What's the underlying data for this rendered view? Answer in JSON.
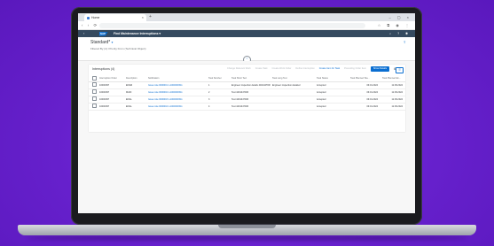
{
  "browser": {
    "tab_title": "Home",
    "tab_close": "×",
    "new_tab": "+",
    "window_controls": "– ▢ ×",
    "nav": "‹ › ⟳",
    "extensions": "☆ ⧉ ◉ ⋮"
  },
  "shell": {
    "back": "‹",
    "logo": "SAP",
    "title": "Find Maintenance Interruptions ▾",
    "icons": "⌕ ? ◉"
  },
  "header": {
    "variant": "Standard*",
    "variant_chevron": "▾",
    "subtitle": "Filtered By (4): Priority From (Technical Object)",
    "expander": "⌃",
    "share": "⇪"
  },
  "table": {
    "title": "Interruptions (4)",
    "actions": [
      {
        "label": "Change Relevant Work",
        "state": "disabled"
      },
      {
        "label": "Create Task",
        "state": "disabled"
      },
      {
        "label": "Create Work Order",
        "state": "disabled"
      },
      {
        "label": "Define Interruption",
        "state": "disabled"
      },
      {
        "label": "Create Item for Task",
        "state": "enabled"
      },
      {
        "label": "Preceding Order Item",
        "state": "disabled"
      },
      {
        "label": "Show Details",
        "state": "button"
      }
    ],
    "settings_icon": "⚙",
    "view_toggle": "☰",
    "columns": [
      "Interruption Order",
      "Description",
      "Notification",
      "Task Number",
      "Task Short Text",
      "Task Long Text",
      "Task Status",
      "Task Planned Sta...",
      "Task Planned En..."
    ],
    "rows": [
      [
        "10000097",
        "ENGR",
        "Issue note 0000001 1-1000001511",
        "1",
        "Engineer inspection details 4401447003",
        "Engineer inspection detailed",
        "Accepted",
        "09.01.2024",
        "12.09.2024"
      ],
      [
        "10000097",
        "MAIN",
        "Issue note 0000002 1-1000001511",
        "2",
        "Test 4401447003",
        "",
        "Accepted",
        "09.01.2024",
        "12.09.2024"
      ],
      [
        "10000097",
        "ENGL",
        "Issue note 0000003 1-1000001511",
        "3",
        "Test 4401447003",
        "",
        "Accepted",
        "09.01.2024",
        "12.09.2024"
      ],
      [
        "10000097",
        "ENGL",
        "Issue note 0000004 1-1000001511",
        "4",
        "Test 4401447003",
        "",
        "Accepted",
        "09.01.2024",
        "12.09.2024"
      ]
    ]
  }
}
